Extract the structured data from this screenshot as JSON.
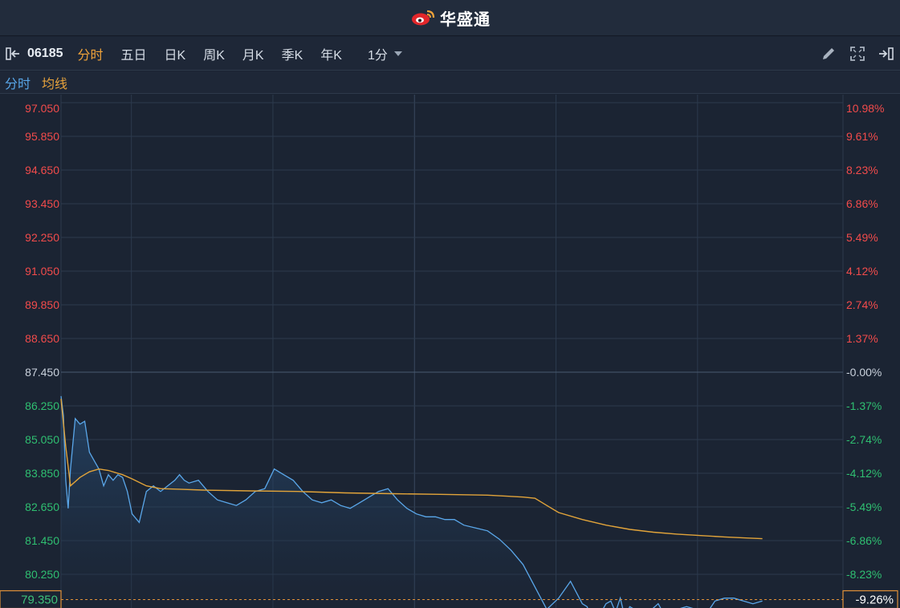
{
  "app": {
    "brand": "华盛通"
  },
  "toolbar": {
    "code": "06185",
    "tabs": [
      "分时",
      "五日",
      "日K",
      "周K",
      "月K",
      "季K",
      "年K"
    ],
    "active_tab": 0,
    "interval": "1分"
  },
  "legend": {
    "price_label": "分时",
    "avg_label": "均线"
  },
  "colors": {
    "up": "#f24b4b",
    "down": "#2fbf71",
    "flat": "#c9d1dc",
    "price_line": "#5aa7ea",
    "avg_line": "#e2a43a",
    "bg": "#1b2433",
    "grid": "#2c3a4d"
  },
  "chart_data": {
    "type": "line",
    "prev_close": 87.45,
    "current_price_label": "79.350",
    "current_pct_label": "-9.26%",
    "ylim": [
      79.05,
      97.05
    ],
    "xlim": [
      0,
      330
    ],
    "y_ticks": [
      97.05,
      95.85,
      94.65,
      93.45,
      92.25,
      91.05,
      89.85,
      88.65,
      87.45,
      86.25,
      85.05,
      83.85,
      82.65,
      81.45,
      80.25
    ],
    "y_tick_labels": [
      "97.050",
      "95.850",
      "94.650",
      "93.450",
      "92.250",
      "91.050",
      "89.850",
      "88.650",
      "87.450",
      "86.250",
      "85.050",
      "83.850",
      "82.650",
      "81.450",
      "80.250"
    ],
    "pct_tick_labels": [
      "10.98%",
      "9.61%",
      "8.23%",
      "6.86%",
      "5.49%",
      "4.12%",
      "2.74%",
      "1.37%",
      "-0.00%",
      "-1.37%",
      "-2.74%",
      "-4.12%",
      "-5.49%",
      "-6.86%",
      "-8.23%"
    ],
    "series": [
      {
        "name": "分时",
        "x": [
          0,
          1,
          2,
          3,
          4,
          6,
          8,
          10,
          12,
          14,
          16,
          18,
          20,
          22,
          24,
          26,
          28,
          30,
          33,
          36,
          39,
          42,
          45,
          48,
          50,
          52,
          54,
          58,
          62,
          66,
          70,
          74,
          78,
          82,
          86,
          90,
          94,
          98,
          102,
          106,
          110,
          114,
          118,
          122,
          126,
          130,
          134,
          138,
          142,
          146,
          150,
          154,
          158,
          162,
          166,
          170,
          175,
          180,
          185,
          190,
          195,
          200,
          205,
          210,
          215,
          220,
          222,
          224,
          226,
          228,
          230,
          232,
          234,
          236,
          238,
          240,
          244,
          248,
          252,
          256,
          260,
          264,
          268,
          272,
          276,
          280,
          284,
          288,
          292,
          296
        ],
        "values": [
          86.6,
          85.9,
          83.6,
          82.6,
          84.0,
          85.8,
          85.6,
          85.7,
          84.6,
          84.3,
          84.0,
          83.4,
          83.8,
          83.6,
          83.8,
          83.7,
          83.2,
          82.4,
          82.1,
          83.2,
          83.4,
          83.2,
          83.4,
          83.6,
          83.8,
          83.6,
          83.5,
          83.6,
          83.2,
          82.9,
          82.8,
          82.7,
          82.9,
          83.2,
          83.3,
          84.0,
          83.8,
          83.6,
          83.2,
          82.9,
          82.8,
          82.9,
          82.7,
          82.6,
          82.8,
          83.0,
          83.2,
          83.3,
          82.9,
          82.6,
          82.4,
          82.3,
          82.3,
          82.2,
          82.2,
          82.0,
          81.9,
          81.8,
          81.5,
          81.1,
          80.6,
          79.8,
          79.0,
          79.4,
          80.0,
          79.2,
          79.1,
          78.7,
          78.6,
          78.9,
          79.2,
          79.3,
          78.9,
          79.4,
          78.7,
          79.1,
          78.9,
          78.9,
          79.2,
          78.6,
          79.0,
          79.1,
          79.0,
          78.8,
          79.3,
          79.4,
          79.4,
          79.3,
          79.2,
          79.3
        ]
      },
      {
        "name": "均线",
        "x": [
          0,
          2,
          4,
          8,
          12,
          16,
          20,
          26,
          30,
          36,
          42,
          50,
          60,
          80,
          100,
          120,
          140,
          160,
          180,
          195,
          200,
          205,
          210,
          220,
          230,
          240,
          250,
          260,
          270,
          280,
          290,
          296
        ],
        "values": [
          86.5,
          84.8,
          83.4,
          83.7,
          83.9,
          84.0,
          83.95,
          83.8,
          83.65,
          83.4,
          83.3,
          83.28,
          83.25,
          83.22,
          83.2,
          83.15,
          83.12,
          83.1,
          83.07,
          83.0,
          82.96,
          82.7,
          82.45,
          82.2,
          82.0,
          81.85,
          81.75,
          81.68,
          81.63,
          81.58,
          81.54,
          81.52
        ]
      }
    ],
    "grid": true
  }
}
